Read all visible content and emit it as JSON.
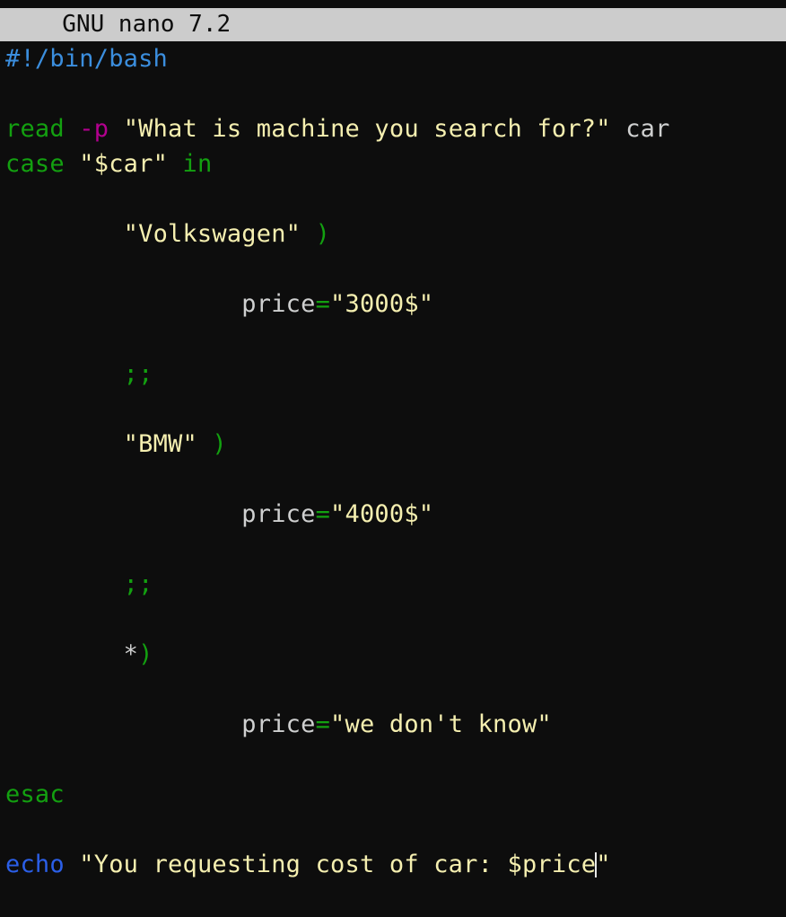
{
  "app": {
    "name": "GNU nano",
    "version": "7.2",
    "titlebar_text": "  GNU nano 7.2",
    "background_color": "#0d0d0d",
    "titlebar_bg_color": "#cccccc",
    "titlebar_fg_color": "#0d0d0d"
  },
  "colors": {
    "comment": "#3b8ede",
    "keyword": "#13a010",
    "string": "#f5efb0",
    "flag": "#b3008f",
    "plain": "#cfd0d0",
    "echo_blue": "#2b5fe8",
    "cursor": "#e8e8e8"
  },
  "editor": {
    "filetype": "bash",
    "cursor": {
      "line": 17,
      "column": 39
    },
    "lines": [
      {
        "n": 1,
        "text": "#!/bin/bash",
        "tokens": [
          {
            "t": "#!/bin/bash",
            "c": "comment"
          }
        ]
      },
      {
        "n": 2,
        "text": "",
        "tokens": []
      },
      {
        "n": 3,
        "text": "read -p \"What is machine you search for?\" car",
        "tokens": [
          {
            "t": "read",
            "c": "keyword"
          },
          {
            "t": " ",
            "c": "plain"
          },
          {
            "t": "-p",
            "c": "flag"
          },
          {
            "t": " ",
            "c": "plain"
          },
          {
            "t": "\"What is machine you search for?\"",
            "c": "string"
          },
          {
            "t": " ",
            "c": "plain"
          },
          {
            "t": "car",
            "c": "plain"
          }
        ]
      },
      {
        "n": 4,
        "text": "case \"$car\" in",
        "tokens": [
          {
            "t": "case",
            "c": "keyword"
          },
          {
            "t": " ",
            "c": "plain"
          },
          {
            "t": "\"$car\"",
            "c": "string"
          },
          {
            "t": " ",
            "c": "plain"
          },
          {
            "t": "in",
            "c": "keyword"
          }
        ]
      },
      {
        "n": 5,
        "text": "",
        "tokens": []
      },
      {
        "n": 6,
        "text": "        \"Volkswagen\" )",
        "tokens": [
          {
            "t": "        ",
            "c": "plain"
          },
          {
            "t": "\"Volkswagen\"",
            "c": "string"
          },
          {
            "t": " ",
            "c": "plain"
          },
          {
            "t": ")",
            "c": "punct"
          }
        ]
      },
      {
        "n": 7,
        "text": "",
        "tokens": []
      },
      {
        "n": 8,
        "text": "                price=\"3000$\"",
        "tokens": [
          {
            "t": "                ",
            "c": "plain"
          },
          {
            "t": "price",
            "c": "plain"
          },
          {
            "t": "=",
            "c": "punct"
          },
          {
            "t": "\"3000$\"",
            "c": "string"
          }
        ]
      },
      {
        "n": 9,
        "text": "",
        "tokens": []
      },
      {
        "n": 10,
        "text": "        ;;",
        "tokens": [
          {
            "t": "        ",
            "c": "plain"
          },
          {
            "t": ";;",
            "c": "punct"
          }
        ]
      },
      {
        "n": 11,
        "text": "",
        "tokens": []
      },
      {
        "n": 12,
        "text": "        \"BMW\" )",
        "tokens": [
          {
            "t": "        ",
            "c": "plain"
          },
          {
            "t": "\"BMW\"",
            "c": "string"
          },
          {
            "t": " ",
            "c": "plain"
          },
          {
            "t": ")",
            "c": "punct"
          }
        ]
      },
      {
        "n": 13,
        "text": "",
        "tokens": []
      },
      {
        "n": 14,
        "text": "                price=\"4000$\"",
        "tokens": [
          {
            "t": "                ",
            "c": "plain"
          },
          {
            "t": "price",
            "c": "plain"
          },
          {
            "t": "=",
            "c": "punct"
          },
          {
            "t": "\"4000$\"",
            "c": "string"
          }
        ]
      },
      {
        "n": 15,
        "text": "",
        "tokens": []
      },
      {
        "n": 16,
        "text": "        ;;",
        "tokens": [
          {
            "t": "        ",
            "c": "plain"
          },
          {
            "t": ";;",
            "c": "punct"
          }
        ]
      },
      {
        "n": 17,
        "text": "",
        "tokens": []
      },
      {
        "n": 18,
        "text": "        *)",
        "tokens": [
          {
            "t": "        ",
            "c": "plain"
          },
          {
            "t": "*",
            "c": "plain"
          },
          {
            "t": ")",
            "c": "punct"
          }
        ]
      },
      {
        "n": 19,
        "text": "",
        "tokens": []
      },
      {
        "n": 20,
        "text": "                price=\"we don't know\"",
        "tokens": [
          {
            "t": "                ",
            "c": "plain"
          },
          {
            "t": "price",
            "c": "plain"
          },
          {
            "t": "=",
            "c": "punct"
          },
          {
            "t": "\"we don't know\"",
            "c": "string"
          }
        ]
      },
      {
        "n": 21,
        "text": "",
        "tokens": []
      },
      {
        "n": 22,
        "text": "esac",
        "tokens": [
          {
            "t": "esac",
            "c": "keyword"
          }
        ]
      },
      {
        "n": 23,
        "text": "",
        "tokens": []
      },
      {
        "n": 24,
        "text": "echo \"You requesting cost of car: $price\"",
        "tokens": [
          {
            "t": "echo",
            "c": "echo_blue"
          },
          {
            "t": " ",
            "c": "plain"
          },
          {
            "t": "\"You requesting cost of car: $price",
            "c": "string"
          },
          {
            "t": "__CURSOR__",
            "c": "cursor"
          },
          {
            "t": "\"",
            "c": "string"
          }
        ]
      },
      {
        "n": 25,
        "text": "",
        "tokens": []
      }
    ]
  }
}
